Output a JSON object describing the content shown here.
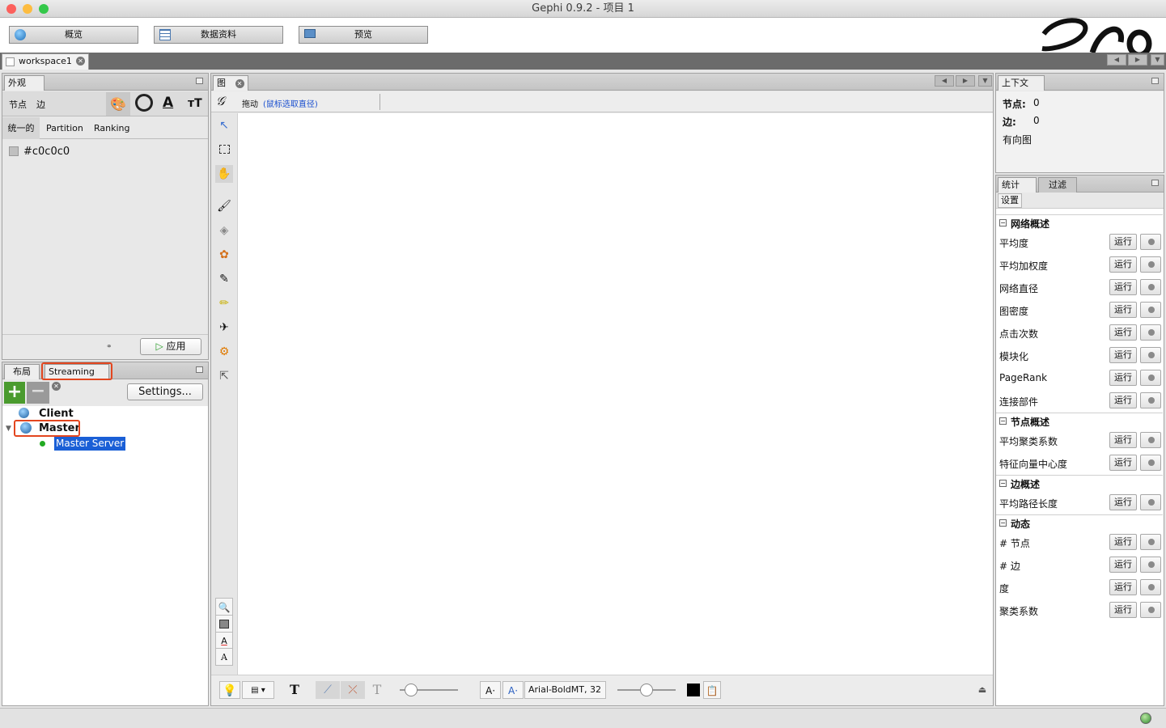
{
  "window": {
    "title": "Gephi 0.9.2 - 项目 1"
  },
  "modes": {
    "overview": "概览",
    "data_lab": "数据资料",
    "preview": "预览"
  },
  "workspace": {
    "tab": "workspace1"
  },
  "appearance": {
    "tab": "外观",
    "nodes": "节点",
    "edges": "边",
    "unique": "统一的",
    "partition": "Partition",
    "ranking": "Ranking",
    "color_value": "#c0c0c0",
    "apply": "应用"
  },
  "streaming": {
    "layout_tab": "布局",
    "tab": "Streaming",
    "settings": "Settings...",
    "client": "Client",
    "master": "Master",
    "master_server": "Master Server"
  },
  "graph": {
    "tab": "图",
    "mode_label": "拖动",
    "mode_hint": "(鼠标选取直径)",
    "font_field": "Arial-BoldMT, 32"
  },
  "context": {
    "tab": "上下文",
    "nodes_label": "节点:",
    "nodes_value": "0",
    "edges_label": "边:",
    "edges_value": "0",
    "graph_type": "有向图"
  },
  "statistics": {
    "tab": "统计",
    "filter_tab": "过滤",
    "settings": "设置",
    "run": "运行",
    "sections": [
      {
        "title": "网络概述",
        "items": [
          "平均度",
          "平均加权度",
          "网络直径",
          "图密度",
          "点击次数",
          "模块化",
          "PageRank",
          "连接部件"
        ]
      },
      {
        "title": "节点概述",
        "items": [
          "平均聚类系数",
          "特征向量中心度"
        ]
      },
      {
        "title": "边概述",
        "items": [
          "平均路径长度"
        ]
      },
      {
        "title": "动态",
        "items": [
          "# 节点",
          "# 边",
          "度",
          "聚类系数"
        ]
      }
    ]
  },
  "colors": {
    "accent_red": "#e3461f",
    "selection_blue": "#1a5fd6",
    "link_blue": "#1a4fcf"
  }
}
